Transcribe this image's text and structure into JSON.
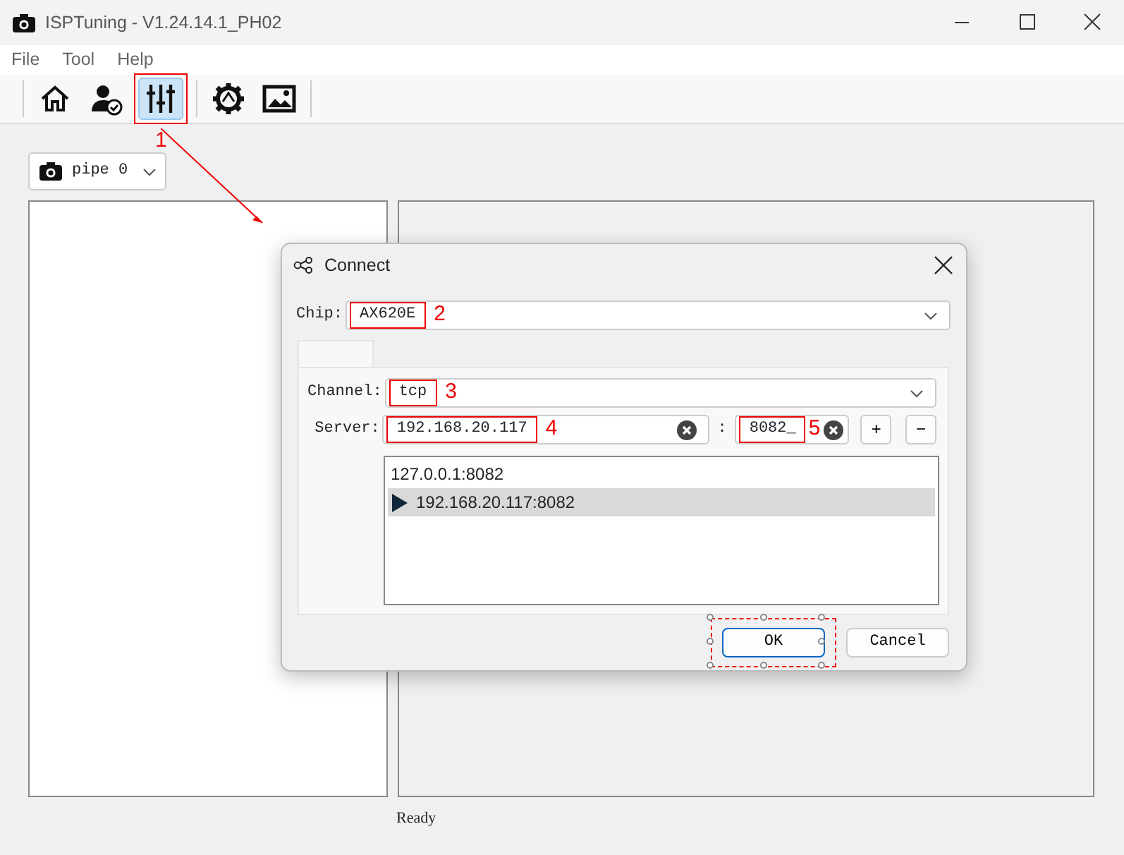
{
  "window": {
    "title": "ISPTuning - V1.24.14.1_PH02"
  },
  "menu": [
    "File",
    "Tool",
    "Help"
  ],
  "toolbar": [
    {
      "kind": "home",
      "selected": false
    },
    {
      "kind": "user",
      "selected": false
    },
    {
      "kind": "sliders",
      "selected": true,
      "callout": "1"
    },
    {
      "kind": "gear",
      "selected": false
    },
    {
      "kind": "image",
      "selected": false
    }
  ],
  "pipe_select": {
    "value": "pipe 0"
  },
  "status_bar": "Ready",
  "dialog": {
    "title": "Connect",
    "chip": {
      "label": "Chip:",
      "value": "AX620E",
      "callout": "2"
    },
    "channel": {
      "label": "Channel:",
      "value": "tcp",
      "callout": "3"
    },
    "server": {
      "label": "Server:",
      "value": "192.168.20.117",
      "callout": "4"
    },
    "port": {
      "separator": ":",
      "value": "8082_",
      "callout": "5"
    },
    "add_button": "+",
    "remove_button": "−",
    "servers": [
      {
        "text": "127.0.0.1:8082",
        "selected": false
      },
      {
        "text": "192.168.20.117:8082",
        "selected": true
      }
    ],
    "ok": "OK",
    "cancel": "Cancel"
  }
}
